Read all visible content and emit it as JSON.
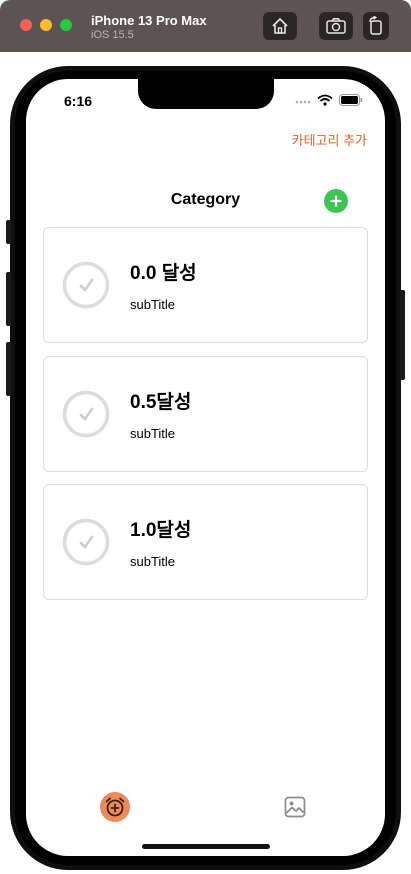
{
  "window": {
    "title": "iPhone 13 Pro Max",
    "subtitle": "iOS 15.5",
    "buttons": [
      "home-icon",
      "camera-icon",
      "rotate-icon"
    ]
  },
  "status_bar": {
    "time": "6:16",
    "icons": [
      "signal-icon",
      "wifi-icon",
      "battery-icon"
    ]
  },
  "nav": {
    "add_category_label": "카테고리 추가",
    "title": "Category",
    "plus_icon": "plus-icon"
  },
  "categories": [
    {
      "title": "0.0 달성",
      "subtitle": "subTitle"
    },
    {
      "title": "0.5달성",
      "subtitle": "subTitle"
    },
    {
      "title": "1.0달성",
      "subtitle": "subTitle"
    }
  ],
  "tab_bar": {
    "items": [
      "alarm-add-icon",
      "photo-icon"
    ],
    "active_color": "#ec8a5a"
  },
  "colors": {
    "accent": "#e2612a",
    "plus_button": "#3cc552",
    "card_border": "#dcdcdc",
    "check_gray": "#dcdcdc"
  }
}
